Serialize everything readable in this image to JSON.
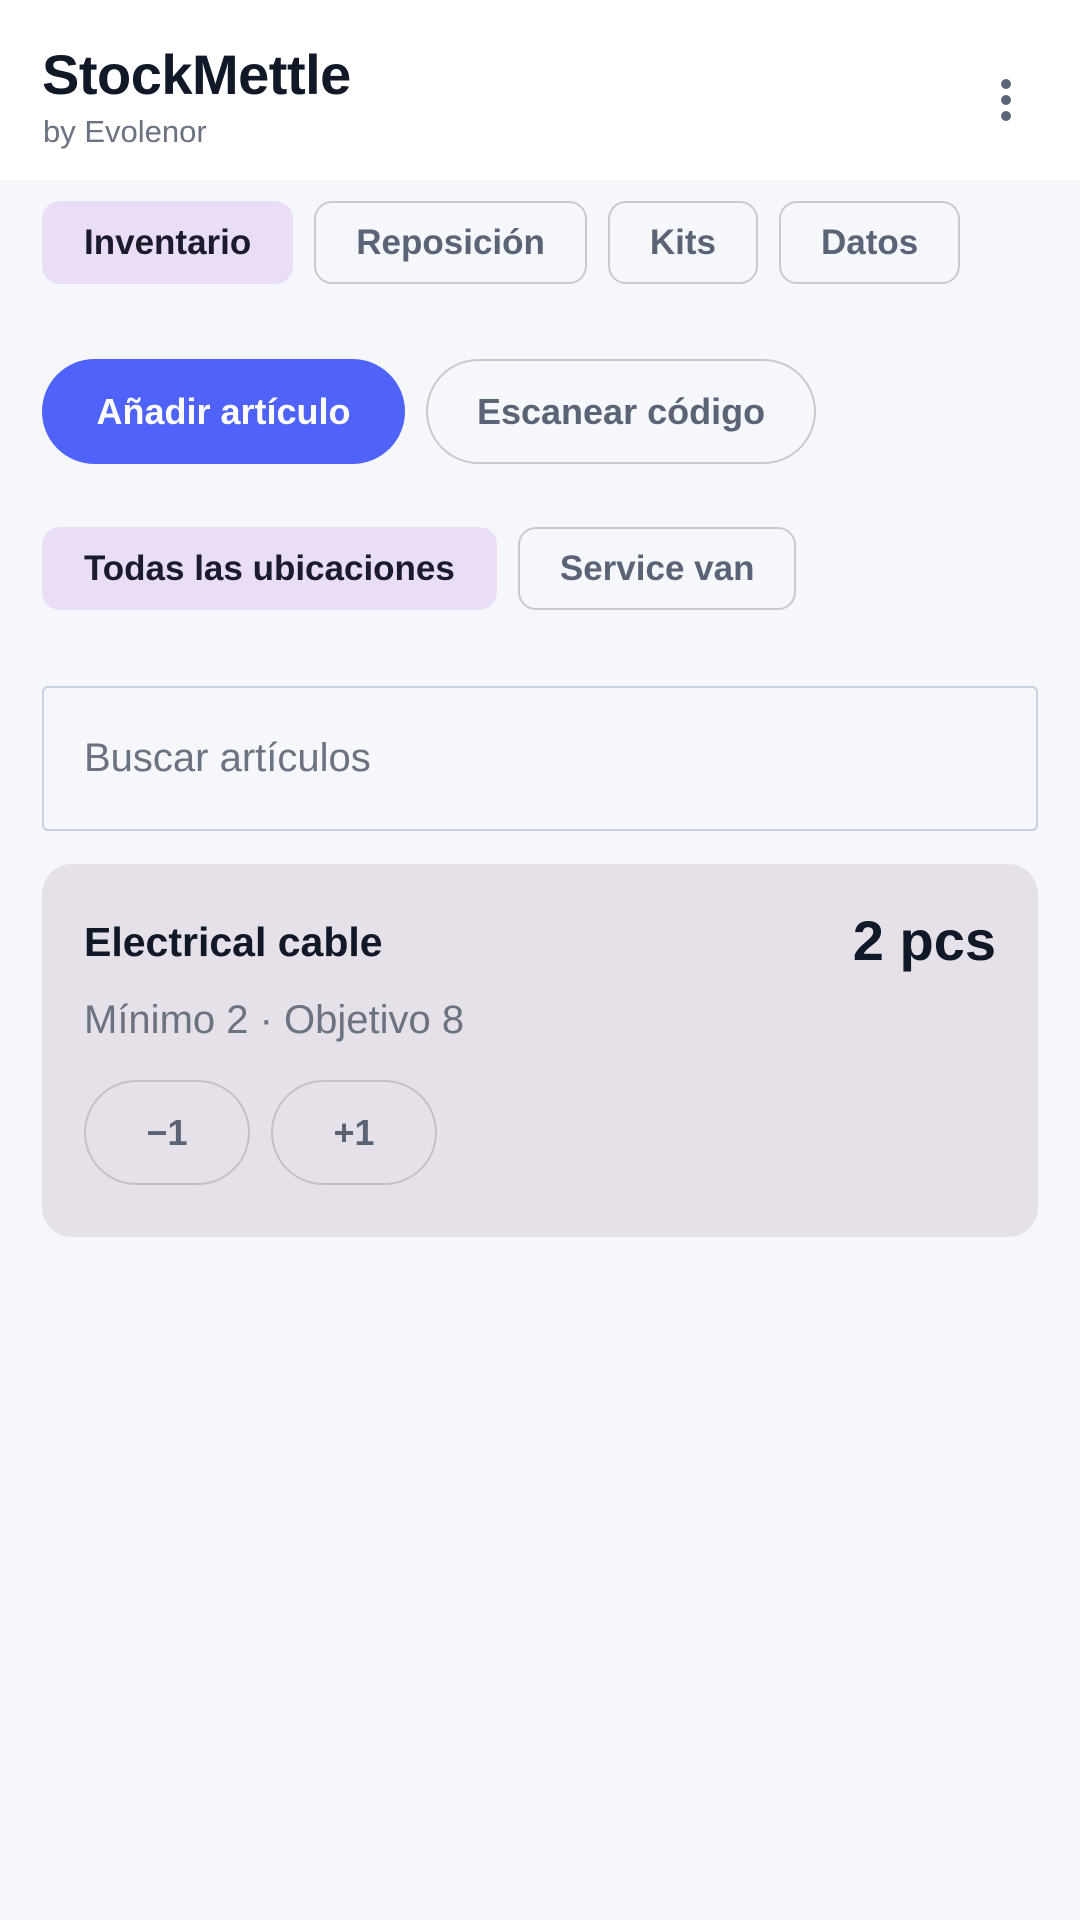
{
  "header": {
    "title": "StockMettle",
    "subtitle": "by Evolenor",
    "menu_icon": "more-vertical-icon"
  },
  "tabs": [
    {
      "label": "Inventario",
      "active": true
    },
    {
      "label": "Reposición",
      "active": false
    },
    {
      "label": "Kits",
      "active": false
    },
    {
      "label": "Datos",
      "active": false
    }
  ],
  "actions": {
    "add_label": "Añadir artículo",
    "scan_label": "Escanear código"
  },
  "locations": [
    {
      "label": "Todas las ubicaciones",
      "active": true
    },
    {
      "label": "Service van",
      "active": false
    }
  ],
  "search": {
    "placeholder": "Buscar artículos",
    "value": ""
  },
  "items": [
    {
      "name": "Electrical cable",
      "quantity": "2 pcs",
      "meta": "Mínimo 2 · Objetivo 8",
      "decrement_label": "−1",
      "increment_label": "+1"
    }
  ],
  "colors": {
    "accent": "#4f63fb",
    "active_chip": "#e9def6",
    "card_bg": "#e6e1e8",
    "page_bg": "#f5f7fb"
  }
}
